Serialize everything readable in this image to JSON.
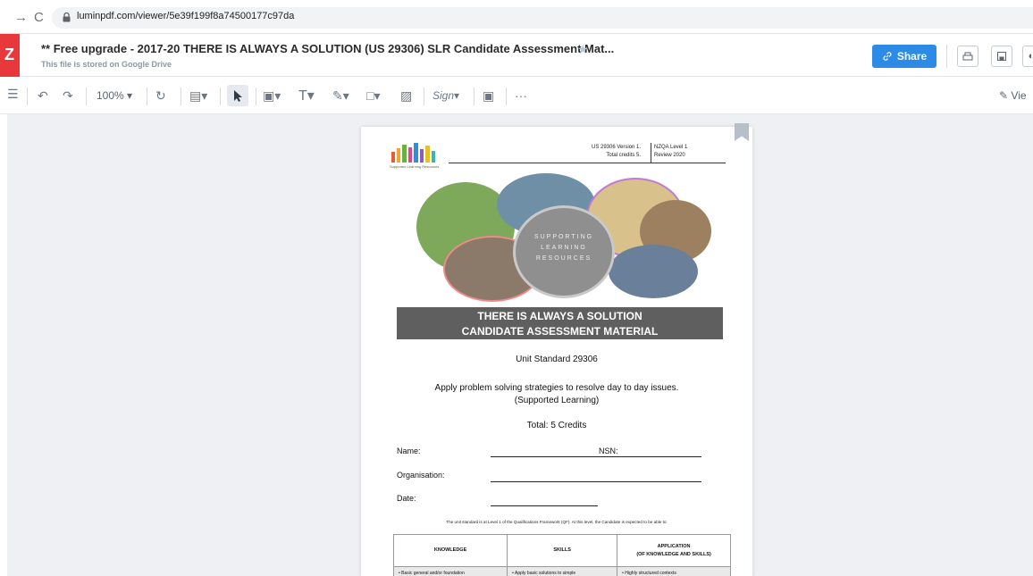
{
  "browser": {
    "url": "luminpdf.com/viewer/5e39f199f8a74500177c97da"
  },
  "header": {
    "title": "** Free upgrade - 2017-20 THERE IS ALWAYS A SOLUTION (US 29306) SLR Candidate Assessment Mat...",
    "subtitle": "This file is stored on Google Drive",
    "share_label": "Share"
  },
  "toolbar": {
    "zoom": "100%",
    "view_mode": "Vie",
    "colors": {
      "accent": "#2b8be6",
      "brand": "#e8383b"
    }
  },
  "document": {
    "us_version": "US 29306 Version 1.",
    "total_credits_short": "Total credits 5.",
    "nzqa_level": "NZQA Level 1",
    "review": "Review 2020",
    "slr_caption": "Supported Learning Resources",
    "collage_text": [
      "SUPPORTING",
      "LEARNING",
      "RESOURCES"
    ],
    "banner_line1": "THERE IS ALWAYS A SOLUTION",
    "banner_line2": "CANDIDATE ASSESSMENT MATERIAL",
    "unit_standard": "Unit Standard 29306",
    "apply_line1": "Apply problem solving strategies to resolve day to day issues.",
    "apply_line2": "(Supported Learning)",
    "total": "Total:  5 Credits",
    "name_label": "Name:",
    "nsn_label": "NSN:",
    "org_label": "Organisation:",
    "date_label": "Date:",
    "note": "The unit standard is at Level 1 of the Qualifications Framework (QF).  At this level, the Candidate is expected to be able to:",
    "table_headers": [
      "KNOWLEDGE",
      "SKILLS",
      "APPLICATION"
    ],
    "table_header_sub": "(OF KNOWLEDGE AND SKILLS)",
    "table_row": [
      "• Basic general and/or foundation",
      "•  Apply basic solutions to simple",
      "•  Highly structured contexts"
    ]
  }
}
